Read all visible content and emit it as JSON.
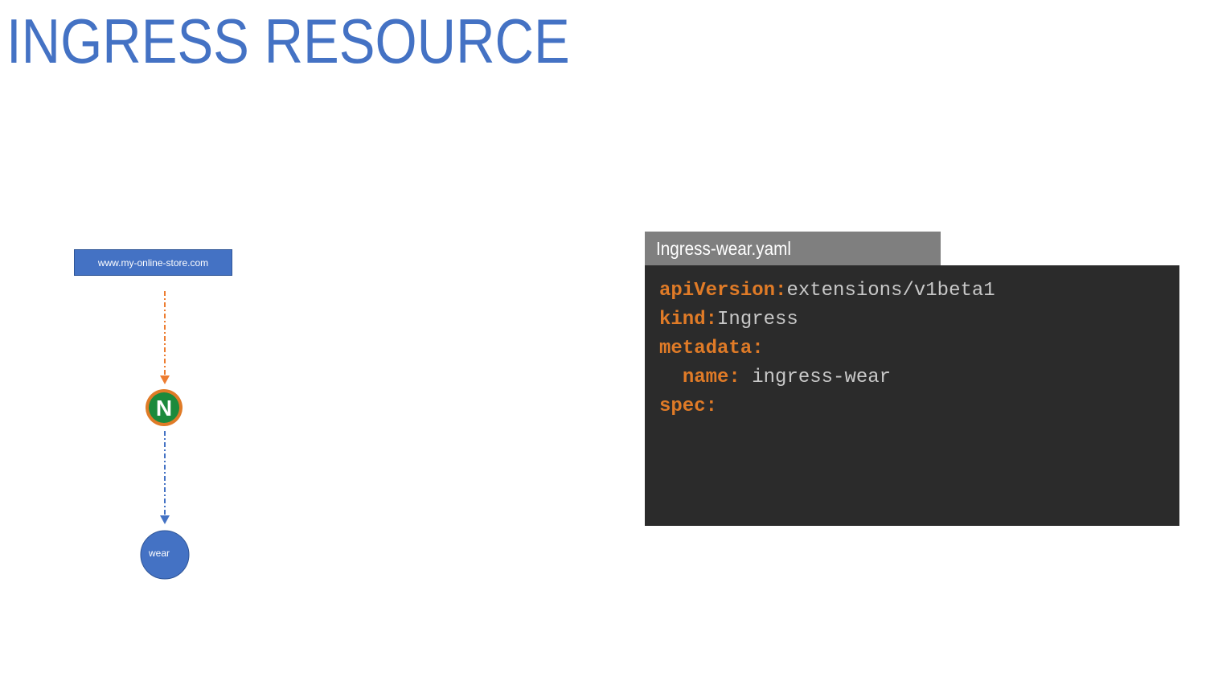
{
  "title": "INGRESS RESOURCE",
  "diagram": {
    "host": "www.my-online-store.com",
    "controller_letter": "N",
    "service": "wear",
    "colors": {
      "accent": "#4472c4",
      "arrow_top": "#ed7d31",
      "arrow_bottom": "#4472c4",
      "controller_ring": "#e07b27",
      "controller_fill": "#1b8a3c"
    }
  },
  "yaml_file": {
    "filename": "Ingress-wear.yaml",
    "lines": [
      {
        "key": "apiVersion:",
        "value": "extensions/v1beta1",
        "indent": ""
      },
      {
        "key": "kind:",
        "value": "Ingress",
        "indent": ""
      },
      {
        "key": "metadata:",
        "value": "",
        "indent": ""
      },
      {
        "key": "name:",
        "value": " ingress-wear",
        "indent": "  "
      },
      {
        "key": "spec:",
        "value": "",
        "indent": ""
      }
    ],
    "colors": {
      "key": "#e07b27",
      "value": "#c8c8c8",
      "background": "#2b2b2b",
      "tab": "#7f7f7f"
    }
  }
}
